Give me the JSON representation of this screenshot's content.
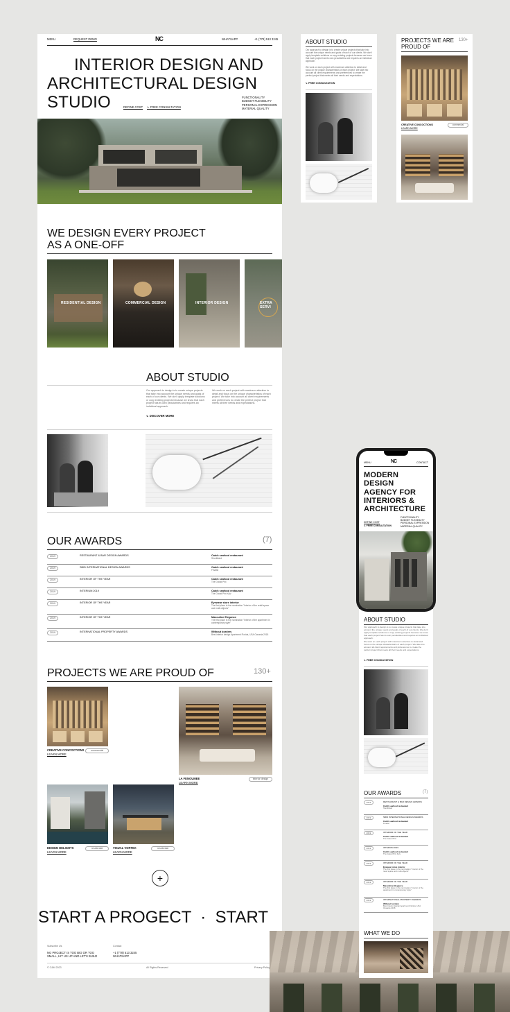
{
  "main": {
    "nav": {
      "menu": "MENU",
      "request_demo": "REQUEST DEMO",
      "logo": "NC",
      "whatsapp": "WHATSAPP",
      "phone": "+1 (778) 513 3245"
    },
    "hero": {
      "title_lines": [
        "INTERIOR DESIGN AND",
        "ARCHITECTURAL DESIGN",
        "STUDIO"
      ],
      "define_cost": "DEFINE COST",
      "free_consultation": "FREE CONSULTATION",
      "qualities": [
        "FUNCTIONALITY",
        "BUDGET FLEXIBILITY",
        "PERSONAL EXPRESSION",
        "MATERIAL QUALITY"
      ]
    },
    "services": {
      "title_lines": [
        "WE DESIGN EVERY PROJECT",
        "AS A ONE-OFF"
      ],
      "cards": [
        "RESIDENTIAL DESIGN",
        "COMMERCIAL DESIGN",
        "INTERIOR DESIGN",
        "EXTRA SERVI"
      ]
    },
    "about": {
      "title": "ABOUT STUDIO",
      "col1": "Our approach to design is to create unique projects that take into account the unique needs and goals of each of our clients. We don't apply template solutions or copy existing projects because we know that each project has its own peculiarities and requires an individual approach.",
      "col2": "We work on each project with maximum attention to detail and focus on the unique characteristics of each project. We take into account all client requirements and preferences to create the perfect project that meets all their needs and expectations.",
      "discover": "DISCOVER MORE"
    },
    "awards": {
      "title": "OUR AWARDS",
      "count": "(7)",
      "rows": [
        {
          "year": "2019",
          "name": "RESTAURANT & BAR DESIGN AWARDS",
          "proj": "Catch seafood restaurant",
          "sub": "Shortlisted"
        },
        {
          "year": "2019",
          "name": "SBID INTERNATIONAL DESIGN AWARDS",
          "proj": "Catch seafood restaurant",
          "sub": "Finalist"
        },
        {
          "year": "2019",
          "name": "INTERIOR OF THE YEAR",
          "proj": "Catch seafood restaurant",
          "sub": "The Grand Prix"
        },
        {
          "year": "2019",
          "name": "INTERIUM 2019",
          "proj": "Catch seafood restaurant",
          "sub": "The Grand Prix Kyiv"
        },
        {
          "year": "2019",
          "name": "INTERIOR OF THE YEAR",
          "proj": "Eyewear store interior",
          "sub": "The first place in the nomination \"Interior of the retail space and multi-objects\""
        },
        {
          "year": "2019",
          "name": "INTERIOR OF THE YEAR",
          "proj": "Masculine Elegance",
          "sub": "The first place in the nomination \"Interior of the apartment in contemporary style\""
        },
        {
          "year": "2019",
          "name": "INTERNATIONAL PROPERTY AWARDS",
          "proj": "Without borders",
          "sub": "Best interior design Apartment Florida, USA Oceania 2018"
        }
      ]
    },
    "projects": {
      "title": "PROJECTS WE ARE PROUD OF",
      "count": "130+",
      "items": [
        {
          "name": "CREATIVE CONCOCTIONS",
          "link": "LEARN MORE",
          "tag": "commercial"
        },
        {
          "name": "LA FENOUMEE",
          "link": "LEARN MORE",
          "tag": "interior design"
        },
        {
          "name": "DESIGN DELIGHTS",
          "link": "LEARN MORE",
          "tag": "residential"
        },
        {
          "name": "VISUAL VORTEX",
          "link": "LEARN MORE",
          "tag": "residential"
        }
      ],
      "plus": "+"
    },
    "marquee": "START A PROGECT  ·  START",
    "footer": {
      "col1_title": "Subscribe Us",
      "col1_lines": [
        "NO PROJECT IS TOO BIG OR TOO",
        "SMALL, HIT US UP AND LET'S BUILD"
      ],
      "col2_title": "Contact",
      "col2_lines": [
        "+1 (778) 513 3245",
        "WHATSAPP"
      ],
      "copyright": "© C&M 2023",
      "rights": "All Rights Reserved",
      "privacy": "Privacy Policy"
    }
  },
  "mini_about": {
    "title": "ABOUT STUDIO",
    "p1": "Our approach to design is to create unique projects that take into account the unique needs and goals of each of our clients. We don't apply template solutions or copy existing projects because we know that each project has its own peculiarities and requires an individual approach.",
    "p2": "We work on each project with maximum attention to detail and focus on the unique characteristics of each project. We take into account all client requirements and preferences to create the perfect project that meets all their needs and expectations.",
    "link": "FREE CONSULTATION"
  },
  "mini_projects": {
    "title_lines": [
      "PROJECTS WE ARE",
      "PROUD OF"
    ],
    "count": "130+",
    "name": "CREATIVE CONCOCTIONS",
    "link": "LEARN MORE",
    "tag": "commercial"
  },
  "phone": {
    "menu": "MENU",
    "logo": "NC",
    "contact": "CONTACT",
    "title_lines": [
      "MODERN",
      "DESIGN",
      "AGENCY FOR",
      "INTERIORS &",
      "ARCHITECTURE"
    ],
    "define_cost": "DEFINE COST",
    "free_consultation": "FREE CONSULTATION",
    "qualities": [
      "FUNCTIONALITY",
      "BUDGET FLEXIBILITY",
      "PERSONAL EXPRESSION",
      "MATERIAL QUALITY"
    ]
  },
  "mobile": {
    "about_title": "ABOUT STUDIO",
    "about_p1": "Our approach to design is to create unique projects that take into account the unique needs and goals of each of our clients. We don't apply template solutions or copy existing projects because we know that each project has its own peculiarities and requires an individual approach.",
    "about_p2": "We work on each project with maximum attention to detail and focus on the unique characteristics of each project. We take into account all client requirements and preferences to create the perfect project that meets all their needs and expectations.",
    "about_link": "FREE CONSULTATION",
    "awards_title": "OUR AWARDS",
    "awards_count": "(7)",
    "awards": [
      {
        "year": "2019",
        "name": "RESTAURANT & BAR DESIGN AWARDS",
        "proj": "Catch seafood restaurant",
        "sub": "Shortlisted"
      },
      {
        "year": "2019",
        "name": "SBID INTERNATIONAL DESIGN AWARDS",
        "proj": "Catch seafood restaurant",
        "sub": "Finalist"
      },
      {
        "year": "2019",
        "name": "INTERIOR OF THE YEAR",
        "proj": "Catch seafood restaurant",
        "sub": "The Grand Prix"
      },
      {
        "year": "2019",
        "name": "INTERIUM 2019",
        "proj": "Catch seafood restaurant",
        "sub": "The Grand Prix Kyiv"
      },
      {
        "year": "2019",
        "name": "INTERIOR OF THE YEAR",
        "proj": "Eyewear store interior",
        "sub": "The first place in the nomination \"Interior of the retail space and multi-objects\""
      },
      {
        "year": "2019",
        "name": "INTERIOR OF THE YEAR",
        "proj": "Masculine Elegance",
        "sub": "The first place in the nomination \"Interior of the apartment in contemporary style\""
      },
      {
        "year": "2019",
        "name": "INTERNATIONAL PROPERTY AWARDS",
        "proj": "Without borders",
        "sub": "Best interior design Apartment Florida, USA Oceania 2018"
      }
    ],
    "what_title": "WHAT WE DO"
  }
}
